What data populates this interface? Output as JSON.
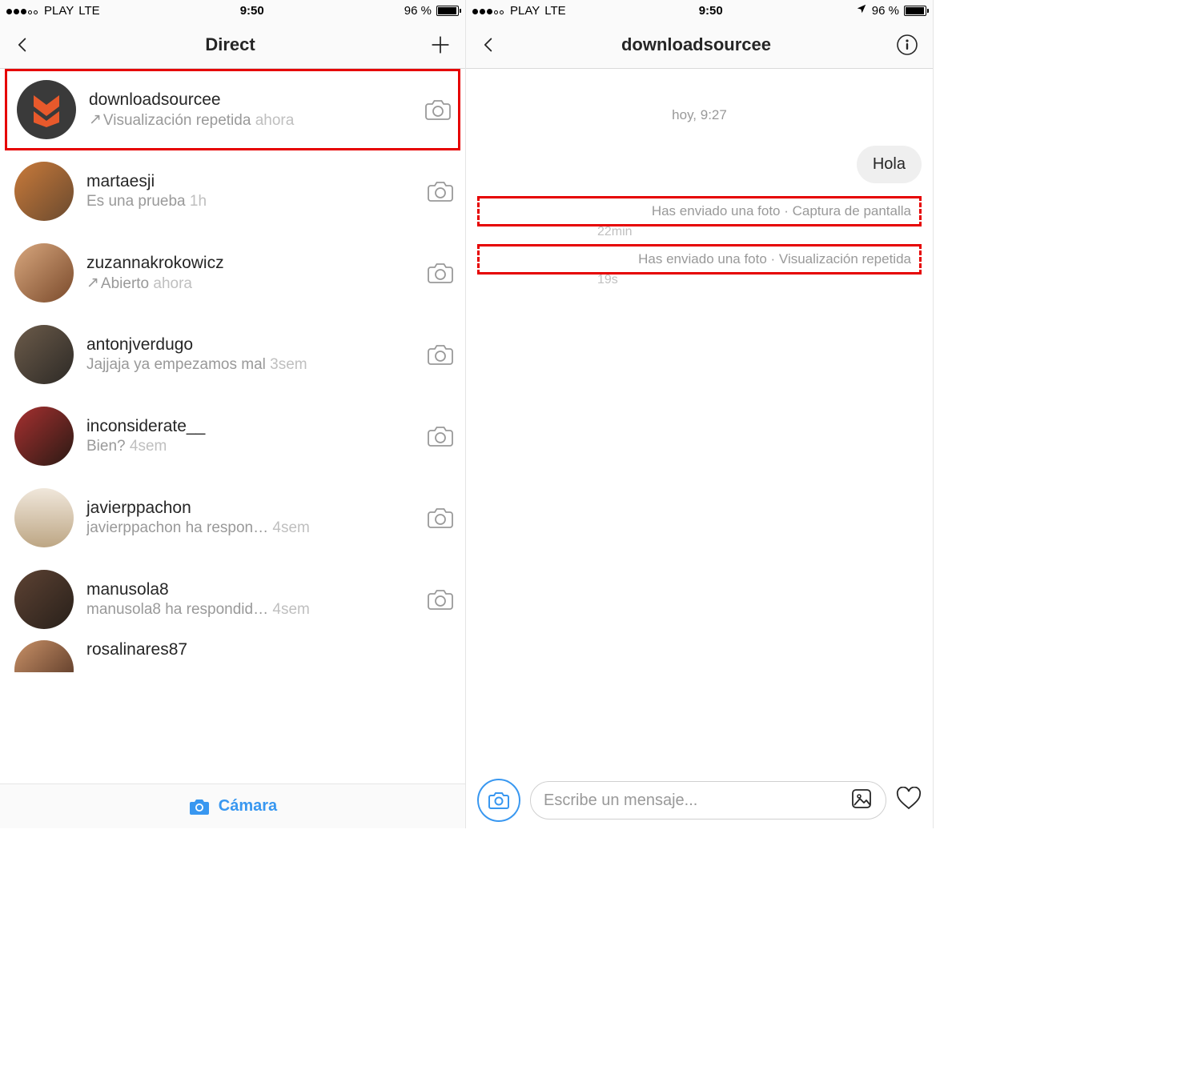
{
  "statusbar": {
    "carrier": "PLAY",
    "network": "LTE",
    "time": "9:50",
    "battery_pct": "96 %"
  },
  "left": {
    "title": "Direct",
    "conversations": [
      {
        "user": "downloadsourcee",
        "preview_prefix": "↗ ",
        "preview": "Visualización repetida",
        "time": "ahora",
        "highlighted": true,
        "avatar": "ds"
      },
      {
        "user": "martaesji",
        "preview_prefix": "",
        "preview": "Es una prueba",
        "time": "1h",
        "avatar": "ph1"
      },
      {
        "user": "zuzannakrokowicz",
        "preview_prefix": "↗ ",
        "preview": "Abierto",
        "time": "ahora",
        "avatar": "ph2"
      },
      {
        "user": "antonjverdugo",
        "preview_prefix": "",
        "preview": "Jajjaja ya empezamos mal",
        "time": "3sem",
        "avatar": "ph3"
      },
      {
        "user": "inconsiderate__",
        "preview_prefix": "",
        "preview": "Bien?",
        "time": "4sem",
        "avatar": "ph4"
      },
      {
        "user": "javierppachon",
        "preview_prefix": "",
        "preview": "javierppachon ha respon…",
        "time": "4sem",
        "avatar": "ph5"
      },
      {
        "user": "manusola8",
        "preview_prefix": "",
        "preview": "manusola8 ha respondid…",
        "time": "4sem",
        "avatar": "ph6"
      },
      {
        "user": "rosalinares87",
        "preview_prefix": "",
        "preview": "",
        "time": "",
        "avatar": "ph7",
        "cut": true
      }
    ],
    "camera_label": "Cámara"
  },
  "right": {
    "title": "downloadsourcee",
    "datestamp": "hoy, 9:27",
    "messages": {
      "outgoing": "Hola",
      "sys1": "Has enviado una foto · Captura de pantalla",
      "sys1_time": "22min",
      "sys2": "Has enviado una foto · Visualización repetida",
      "sys2_time": "19s"
    },
    "composer_placeholder": "Escribe un mensaje..."
  }
}
